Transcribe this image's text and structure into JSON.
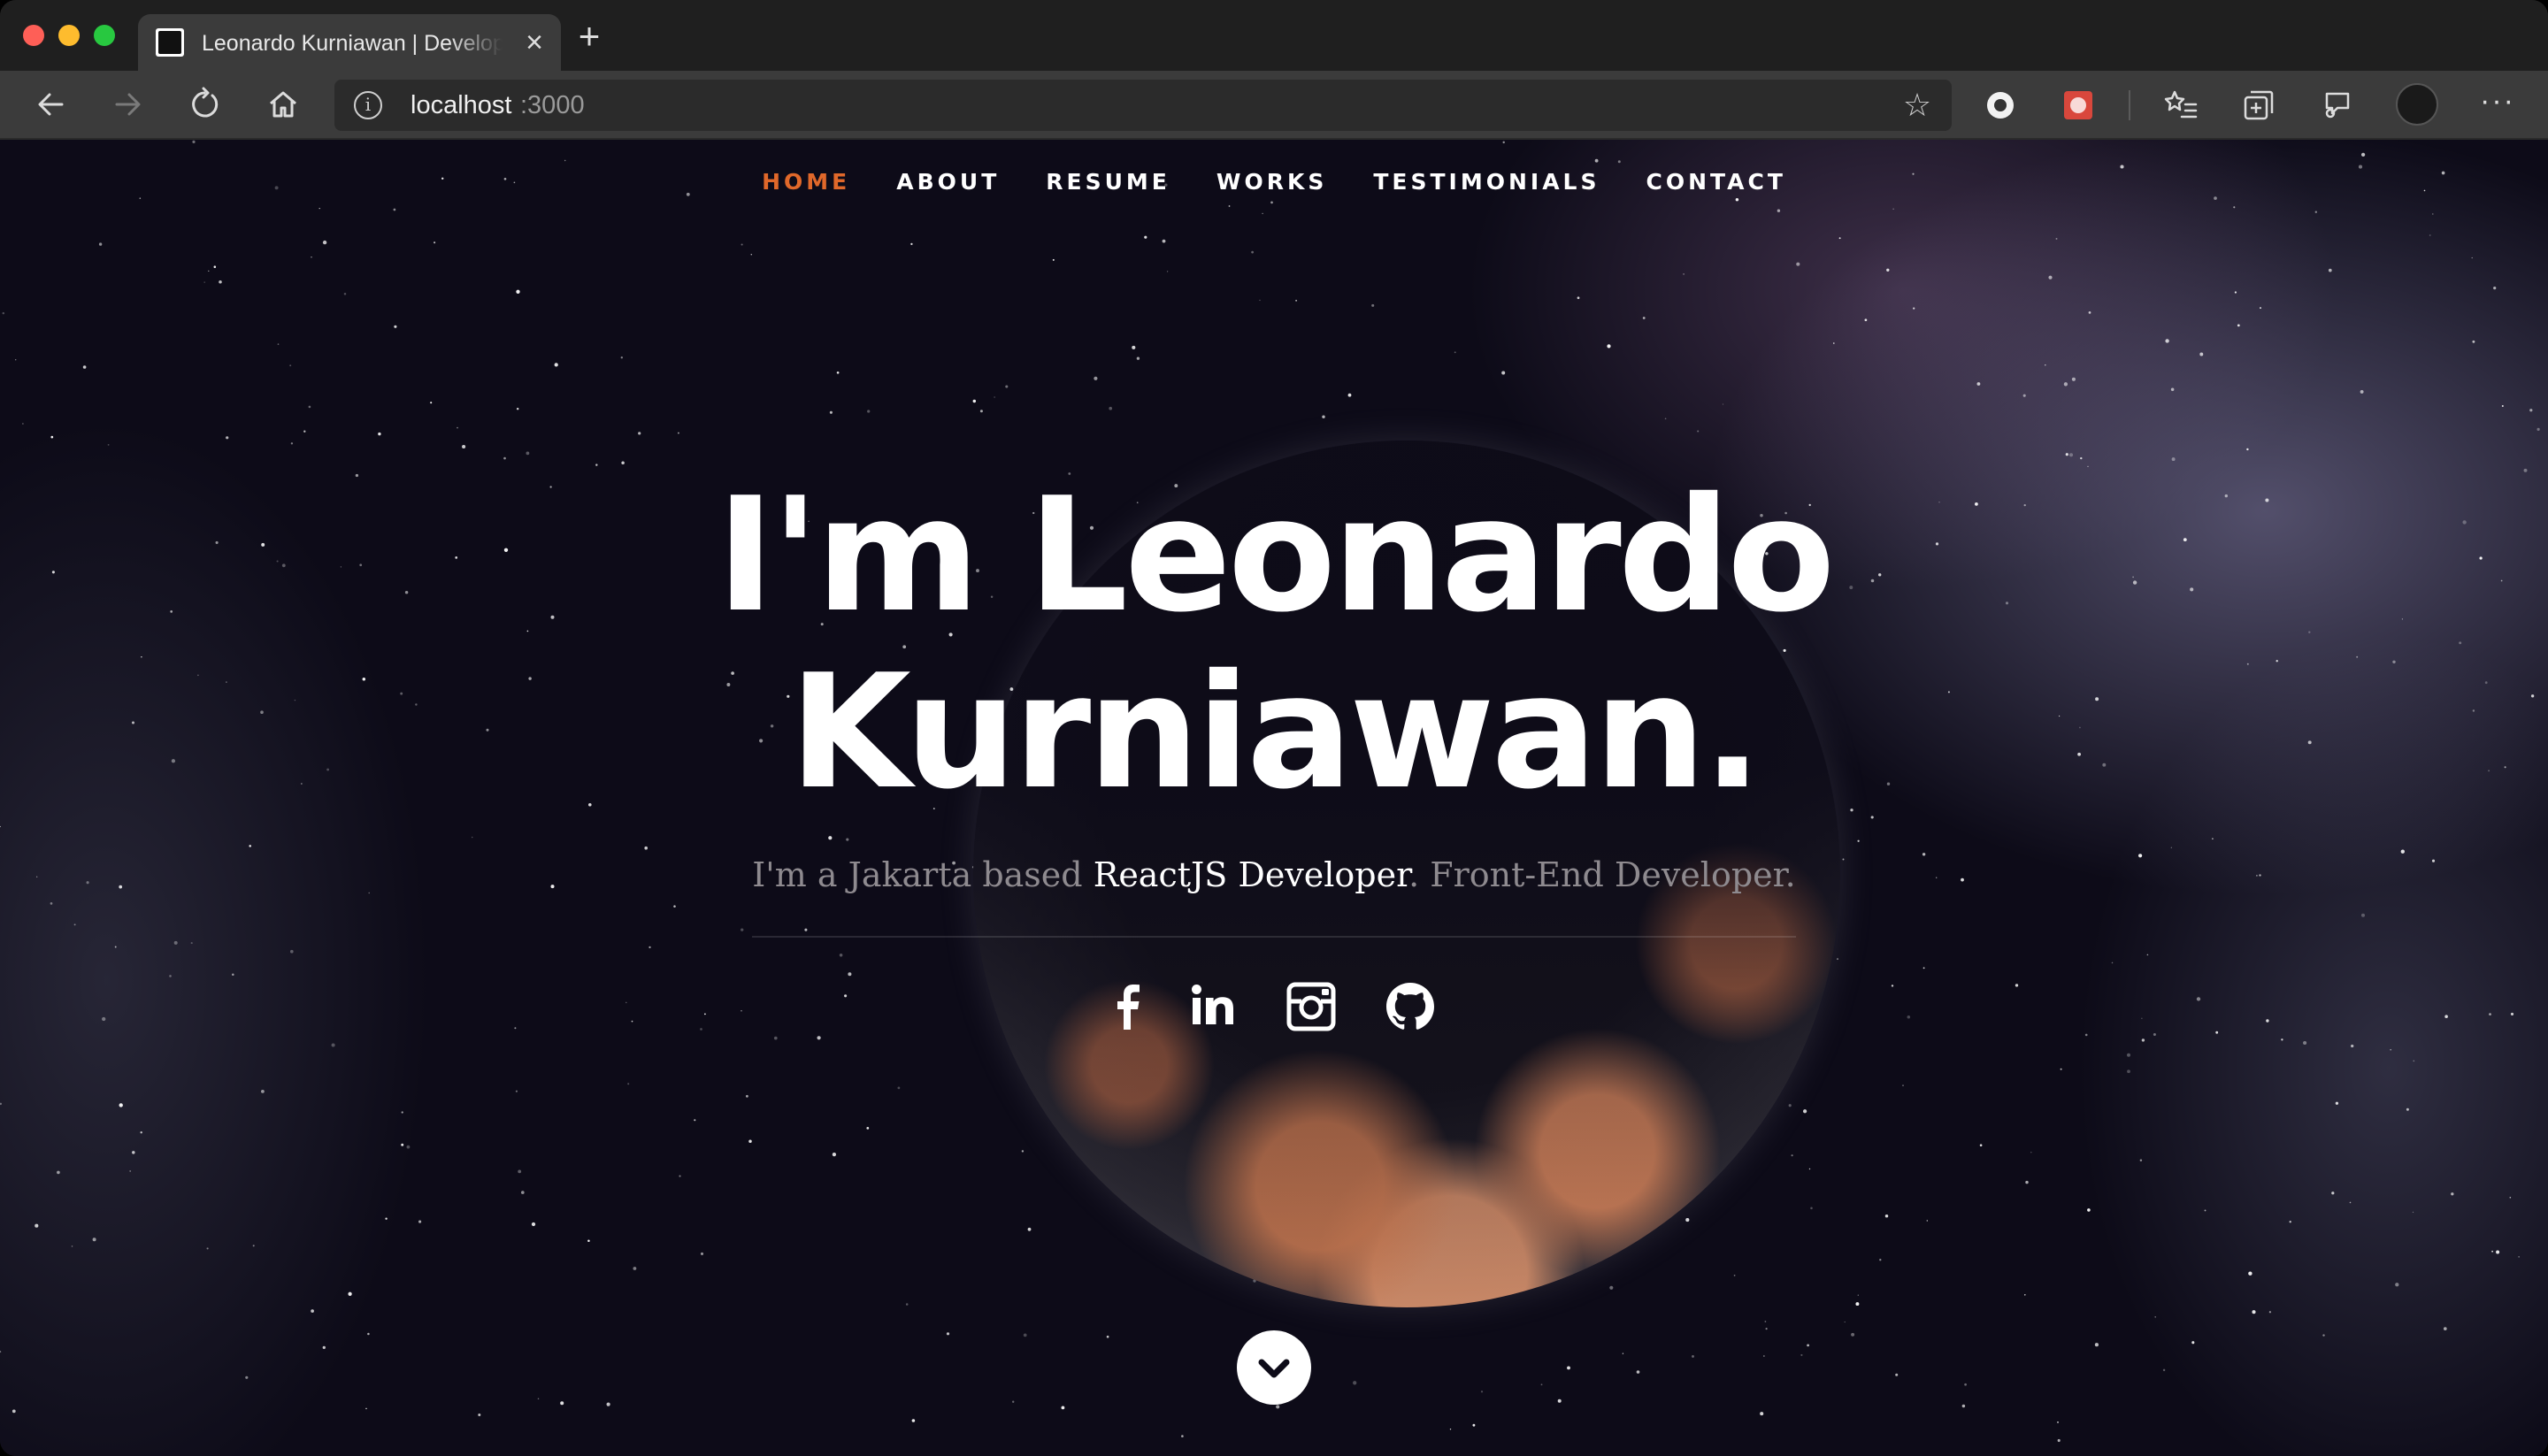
{
  "browser": {
    "tab_title": "Leonardo Kurniawan | Developer",
    "address_host": "localhost",
    "address_port": ":3000",
    "tab_close": "×",
    "new_tab": "+",
    "more": "···",
    "star": "☆",
    "info": "i"
  },
  "nav": {
    "items": [
      "HOME",
      "ABOUT",
      "RESUME",
      "WORKS",
      "TESTIMONIALS",
      "CONTACT"
    ],
    "active_color": "#e0682a"
  },
  "hero": {
    "title_line1": "I'm Leonardo",
    "title_line2": "Kurniawan.",
    "sub_prefix": "I'm a Jakarta based ",
    "sub_highlight": "ReactJS Developer",
    "sub_suffix": ". Front-End Developer."
  },
  "social": [
    "facebook-icon",
    "linkedin-icon",
    "instagram-icon",
    "github-icon"
  ],
  "colors": {
    "accent": "#e0682a",
    "background": "#0d0b18"
  }
}
